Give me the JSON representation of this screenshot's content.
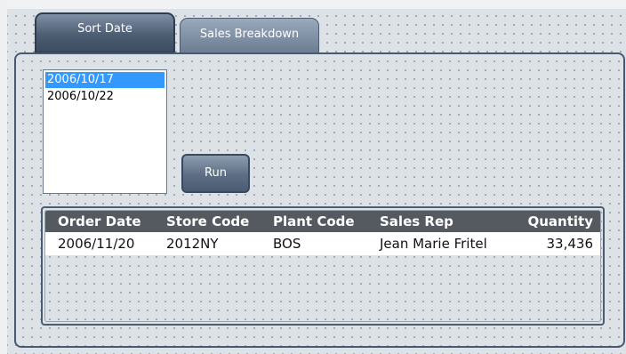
{
  "tabs": [
    {
      "label": "Sort Date",
      "active": true
    },
    {
      "label": "Sales Breakdown",
      "active": false
    }
  ],
  "date_list": {
    "items": [
      "2006/10/17",
      "2006/10/22"
    ],
    "selected": "2006/10/17"
  },
  "run_button": {
    "label": "Run"
  },
  "table": {
    "columns": [
      "Order Date",
      "Store Code",
      "Plant Code",
      "Sales Rep",
      "Quantity"
    ],
    "rows": [
      [
        "2006/11/20",
        "2012NY",
        "BOS",
        "Jean Marie Fritel",
        "33,436"
      ]
    ]
  },
  "colors": {
    "background": "#dde2e7",
    "tab_active": "#4d5d72",
    "header_bg": "#555a60",
    "selection": "#3399ff"
  }
}
